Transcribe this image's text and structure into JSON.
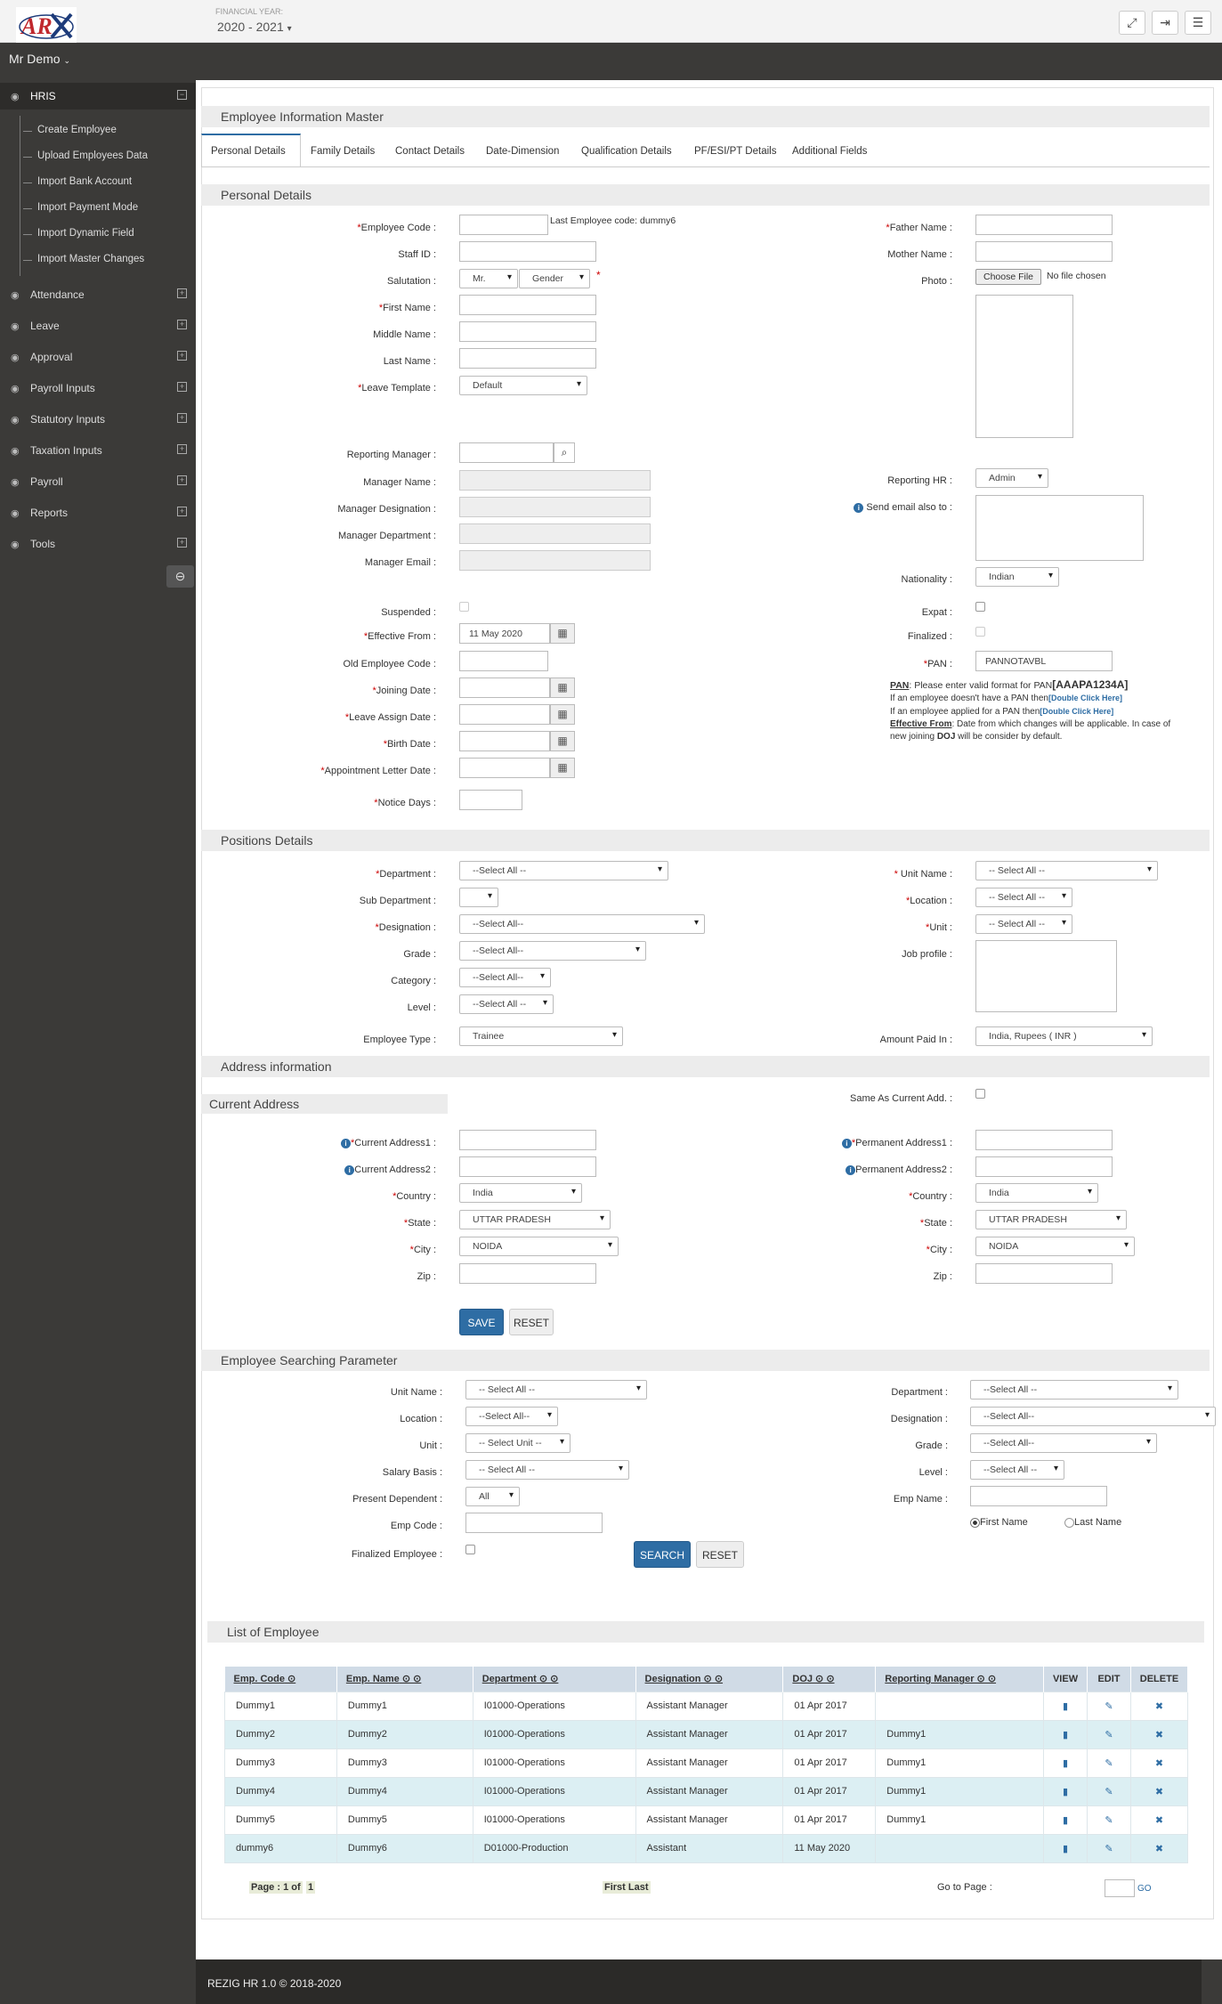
{
  "header": {
    "fy_label": "FINANCIAL YEAR:",
    "fy_value": "2020 - 2021"
  },
  "user": {
    "name": "Mr Demo"
  },
  "sidebar": {
    "hris": "HRIS",
    "hris_sub": [
      "Create Employee",
      "Upload Employees Data",
      "Import Bank Account",
      "Import Payment Mode",
      "Import Dynamic Field",
      "Import Master Changes"
    ],
    "items": [
      "Attendance",
      "Leave",
      "Approval",
      "Payroll Inputs",
      "Statutory Inputs",
      "Taxation Inputs",
      "Payroll",
      "Reports",
      "Tools"
    ]
  },
  "page": {
    "title": "Employee Information Master"
  },
  "tabs": [
    "Personal Details",
    "Family Details",
    "Contact Details",
    "Date-Dimension",
    "Qualification Details",
    "PF/ESI/PT Details",
    "Additional Fields"
  ],
  "personal": {
    "section": "Personal Details",
    "employee_code": "Employee Code :",
    "last_code": "Last Employee code: dummy6",
    "staff_id": "Staff ID :",
    "salutation": "Salutation :",
    "salutation_val": "Mr.",
    "gender_val": "Gender",
    "first_name": "First Name :",
    "middle_name": "Middle Name :",
    "last_name": "Last Name :",
    "leave_template": "Leave Template :",
    "leave_template_val": "Default",
    "father_name": "Father Name :",
    "mother_name": "Mother Name :",
    "photo": "Photo :",
    "choose_file": "Choose File",
    "no_file": "No file chosen",
    "reporting_manager": "Reporting Manager :",
    "manager_name": "Manager Name :",
    "manager_designation": "Manager Designation :",
    "manager_department": "Manager Department :",
    "manager_email": "Manager Email :",
    "reporting_hr": "Reporting HR :",
    "reporting_hr_val": "Admin",
    "send_email": "Send email also to :",
    "nationality": "Nationality :",
    "nationality_val": "Indian",
    "suspended": "Suspended :",
    "effective_from": "Effective From :",
    "effective_from_val": "11 May 2020",
    "old_code": "Old Employee Code :",
    "joining_date": "Joining Date :",
    "leave_assign_date": "Leave Assign Date :",
    "birth_date": "Birth Date :",
    "appointment_date": "Appointment Letter Date :",
    "notice_days": "Notice Days :",
    "expat": "Expat :",
    "finalized": "Finalized :",
    "pan": "PAN :",
    "pan_val": "PANNOTAVBL",
    "pan_note1a": "PAN",
    "pan_note1b": ": Please enter valid format for PAN",
    "pan_note1c": "[AAAPA1234A]",
    "pan_note2a": "If an employee doesn't have a PAN then",
    "pan_note2b": "[Double Click Here]",
    "pan_note3a": "If an employee applied for a PAN then",
    "pan_note3b": "[Double Click Here]",
    "eff_note_a": "Effective From",
    "eff_note_b": ": Date from which changes will be applicable. In case of",
    "eff_note_c": "new joining ",
    "eff_note_d": "DOJ",
    "eff_note_e": " will be consider by default."
  },
  "positions": {
    "section": "Positions Details",
    "department": "Department :",
    "department_val": "--Select All --",
    "sub_department": "Sub Department :",
    "designation": "Designation :",
    "designation_val": "--Select All--",
    "grade": "Grade :",
    "grade_val": "--Select All--",
    "category": "Category :",
    "category_val": "--Select All--",
    "level": "Level :",
    "level_val": "--Select All --",
    "employee_type": "Employee Type :",
    "employee_type_val": "Trainee",
    "unit_name": "Unit Name :",
    "unit_name_val": "-- Select All --",
    "location": "Location :",
    "location_val": "-- Select All --",
    "unit": "Unit :",
    "unit_val": "-- Select All --",
    "job_profile": "Job profile :",
    "amount_paid": "Amount Paid In :",
    "amount_paid_val": "India, Rupees ( INR )"
  },
  "address": {
    "section": "Address information",
    "current": "Current Address",
    "same_as": "Same As Current Add. :",
    "cur_addr1": "Current Address1 :",
    "cur_addr2": "Current Address2 :",
    "country": "Country :",
    "country_val": "India",
    "state": "State :",
    "state_val": "UTTAR PRADESH",
    "city": "City :",
    "city_val": "NOIDA",
    "zip": "Zip :",
    "perm_addr1": "Permanent Address1 :",
    "perm_addr2": "Permanent Address2 :",
    "save": "SAVE",
    "reset": "RESET"
  },
  "search": {
    "section": "Employee Searching Parameter",
    "unit_name": "Unit Name :",
    "unit_name_val": "-- Select All --",
    "location": "Location :",
    "location_val": "--Select All--",
    "unit": "Unit :",
    "unit_val": "-- Select Unit --",
    "salary_basis": "Salary Basis :",
    "salary_basis_val": "-- Select All --",
    "present_dependent": "Present Dependent :",
    "present_dependent_val": "All",
    "emp_code": "Emp Code :",
    "finalized": "Finalized Employee :",
    "department": "Department :",
    "department_val": "--Select All --",
    "designation": "Designation :",
    "designation_val": "--Select All--",
    "grade": "Grade :",
    "grade_val": "--Select All--",
    "level": "Level :",
    "level_val": "--Select All --",
    "emp_name": "Emp Name :",
    "first_name": "First Name",
    "last_name": "Last Name",
    "search_btn": "SEARCH",
    "reset_btn": "RESET"
  },
  "list": {
    "section": "List of Employee",
    "headers": [
      "Emp. Code",
      "Emp. Name",
      "Department",
      "Designation",
      "DOJ",
      "Reporting Manager",
      "VIEW",
      "EDIT",
      "DELETE"
    ],
    "rows": [
      [
        "Dummy1",
        "Dummy1",
        "I01000-Operations",
        "Assistant Manager",
        "01 Apr 2017",
        ""
      ],
      [
        "Dummy2",
        "Dummy2",
        "I01000-Operations",
        "Assistant Manager",
        "01 Apr 2017",
        "Dummy1"
      ],
      [
        "Dummy3",
        "Dummy3",
        "I01000-Operations",
        "Assistant Manager",
        "01 Apr 2017",
        "Dummy1"
      ],
      [
        "Dummy4",
        "Dummy4",
        "I01000-Operations",
        "Assistant Manager",
        "01 Apr 2017",
        "Dummy1"
      ],
      [
        "Dummy5",
        "Dummy5",
        "I01000-Operations",
        "Assistant Manager",
        "01 Apr 2017",
        "Dummy1"
      ],
      [
        "dummy6",
        "Dummy6",
        "D01000-Production",
        "Assistant",
        "11 May 2020",
        ""
      ]
    ],
    "page_info": "Page : 1 of",
    "page_num": "1",
    "first_last": "First Last",
    "go_to": "Go to Page :",
    "go": "GO"
  },
  "footer": {
    "text": "REZIG HR 1.0 © 2018-2020"
  },
  "colors": {
    "accent": "#2e6da4",
    "sidebar": "#3b3a38",
    "row_alt": "#dceff3",
    "required": "#cc0000"
  }
}
